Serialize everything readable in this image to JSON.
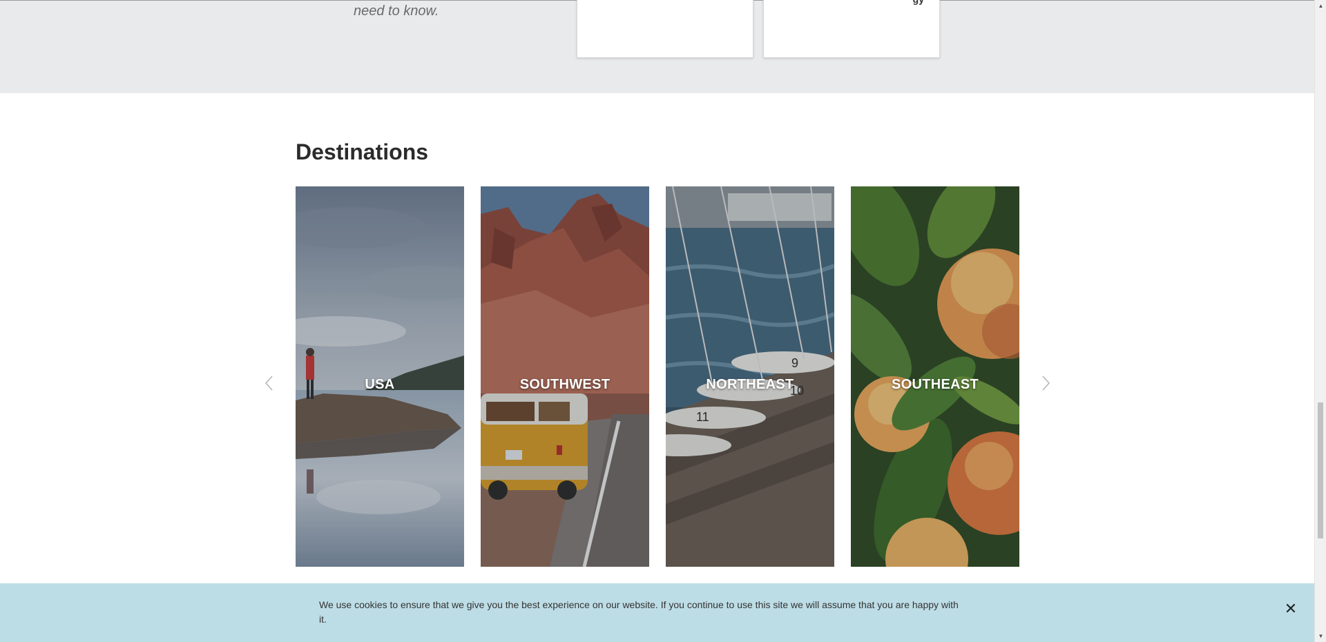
{
  "top_section": {
    "tagline": "need to know.",
    "card_fragment": "gy"
  },
  "destinations": {
    "title": "Destinations",
    "tiles": [
      {
        "label": "USA"
      },
      {
        "label": "SOUTHWEST"
      },
      {
        "label": "NORTHEAST"
      },
      {
        "label": "SOUTHEAST"
      }
    ],
    "prev_icon": "chevron-left-icon",
    "next_icon": "chevron-right-icon"
  },
  "cookie_bar": {
    "message": "We use cookies to ensure that we give you the best experience on our website. If you continue to use this site we will assume that you are happy with it.",
    "close_symbol": "✕"
  },
  "scrollbar": {
    "up_symbol": "▲",
    "down_symbol": "▼"
  },
  "colors": {
    "band": "#e9eaec",
    "cookie_bg": "#bddde6",
    "title_text": "#2b2b2b"
  }
}
